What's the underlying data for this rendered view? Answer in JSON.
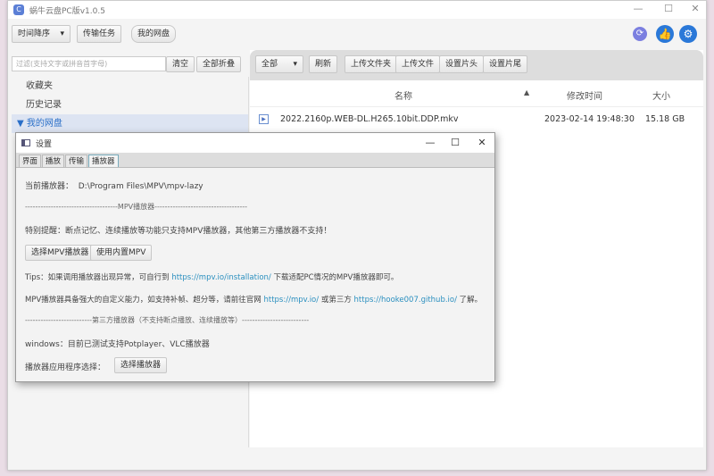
{
  "window": {
    "title": "蜗牛云盘PC版v1.0.5",
    "minimize": "—",
    "maximize": "☐",
    "close": "✕"
  },
  "toolbar": {
    "sort": "时间降序",
    "transfer": "传输任务",
    "mydisk": "我的网盘"
  },
  "top_icons": [
    {
      "name": "refresh-icon",
      "color": "#7b7fe0"
    },
    {
      "name": "thumbs-up-icon",
      "color": "#2a78d8"
    },
    {
      "name": "gear-icon",
      "color": "#2a78d8"
    }
  ],
  "filter": {
    "placeholder": "过滤(支持文字或拼音首字母)",
    "clear": "清空",
    "collapse": "全部折叠"
  },
  "sidebar": {
    "items": [
      {
        "label": "收藏夹"
      },
      {
        "label": "历史记录"
      },
      {
        "label": "▼ 我的网盘"
      }
    ]
  },
  "file_toolbar": {
    "filter": "全部",
    "refresh": "刷新",
    "upload_folder": "上传文件夹",
    "upload_file": "上传文件",
    "set_intro": "设置片头",
    "set_outro": "设置片尾"
  },
  "table": {
    "columns": [
      "名称",
      "修改时间",
      "大小"
    ],
    "sort_indicator": "▲",
    "rows": [
      {
        "name": "2022.2160p.WEB-DL.H265.10bit.DDP.mkv",
        "modified": "2023-02-14 19:48:30",
        "size": "15.18 GB"
      }
    ]
  },
  "dialog": {
    "title": "设置",
    "tabs": [
      "界面",
      "播放",
      "传输",
      "播放器"
    ],
    "current_label": "当前播放器：",
    "current_value": "D:\\Program Files\\MPV\\mpv-lazy",
    "mpv_sep": "------------------------------------MPV播放器------------------------------------",
    "notice": "特别提醒：断点记忆、连续播放等功能只支持MPV播放器，其他第三方播放器不支持！",
    "select_mpv": "选择MPV播放器",
    "builtin_mpv": "使用内置MPV",
    "tips_pre": "Tips：如果调用播放器出现异常，可自行到 ",
    "tips_link": "https://mpv.io/installation/",
    "tips_post": " 下载适配PC情况的MPV播放器即可。",
    "mpv_pre": "MPV播放器具备强大的自定义能力，如支持补帧、超分等，请前往官网 ",
    "mpv_link1": "https://mpv.io/",
    "mpv_mid": " 或第三方 ",
    "mpv_link2": "https://hooke007.github.io/",
    "mpv_post": " 了解。",
    "third_sep": "--------------------------第三方播放器（不支持断点播放、连续播放等）--------------------------",
    "windows_note": "windows：目前已测试支持Potplayer、VLC播放器",
    "app_label": "播放器应用程序选择：",
    "select_player": "选择播放器"
  }
}
